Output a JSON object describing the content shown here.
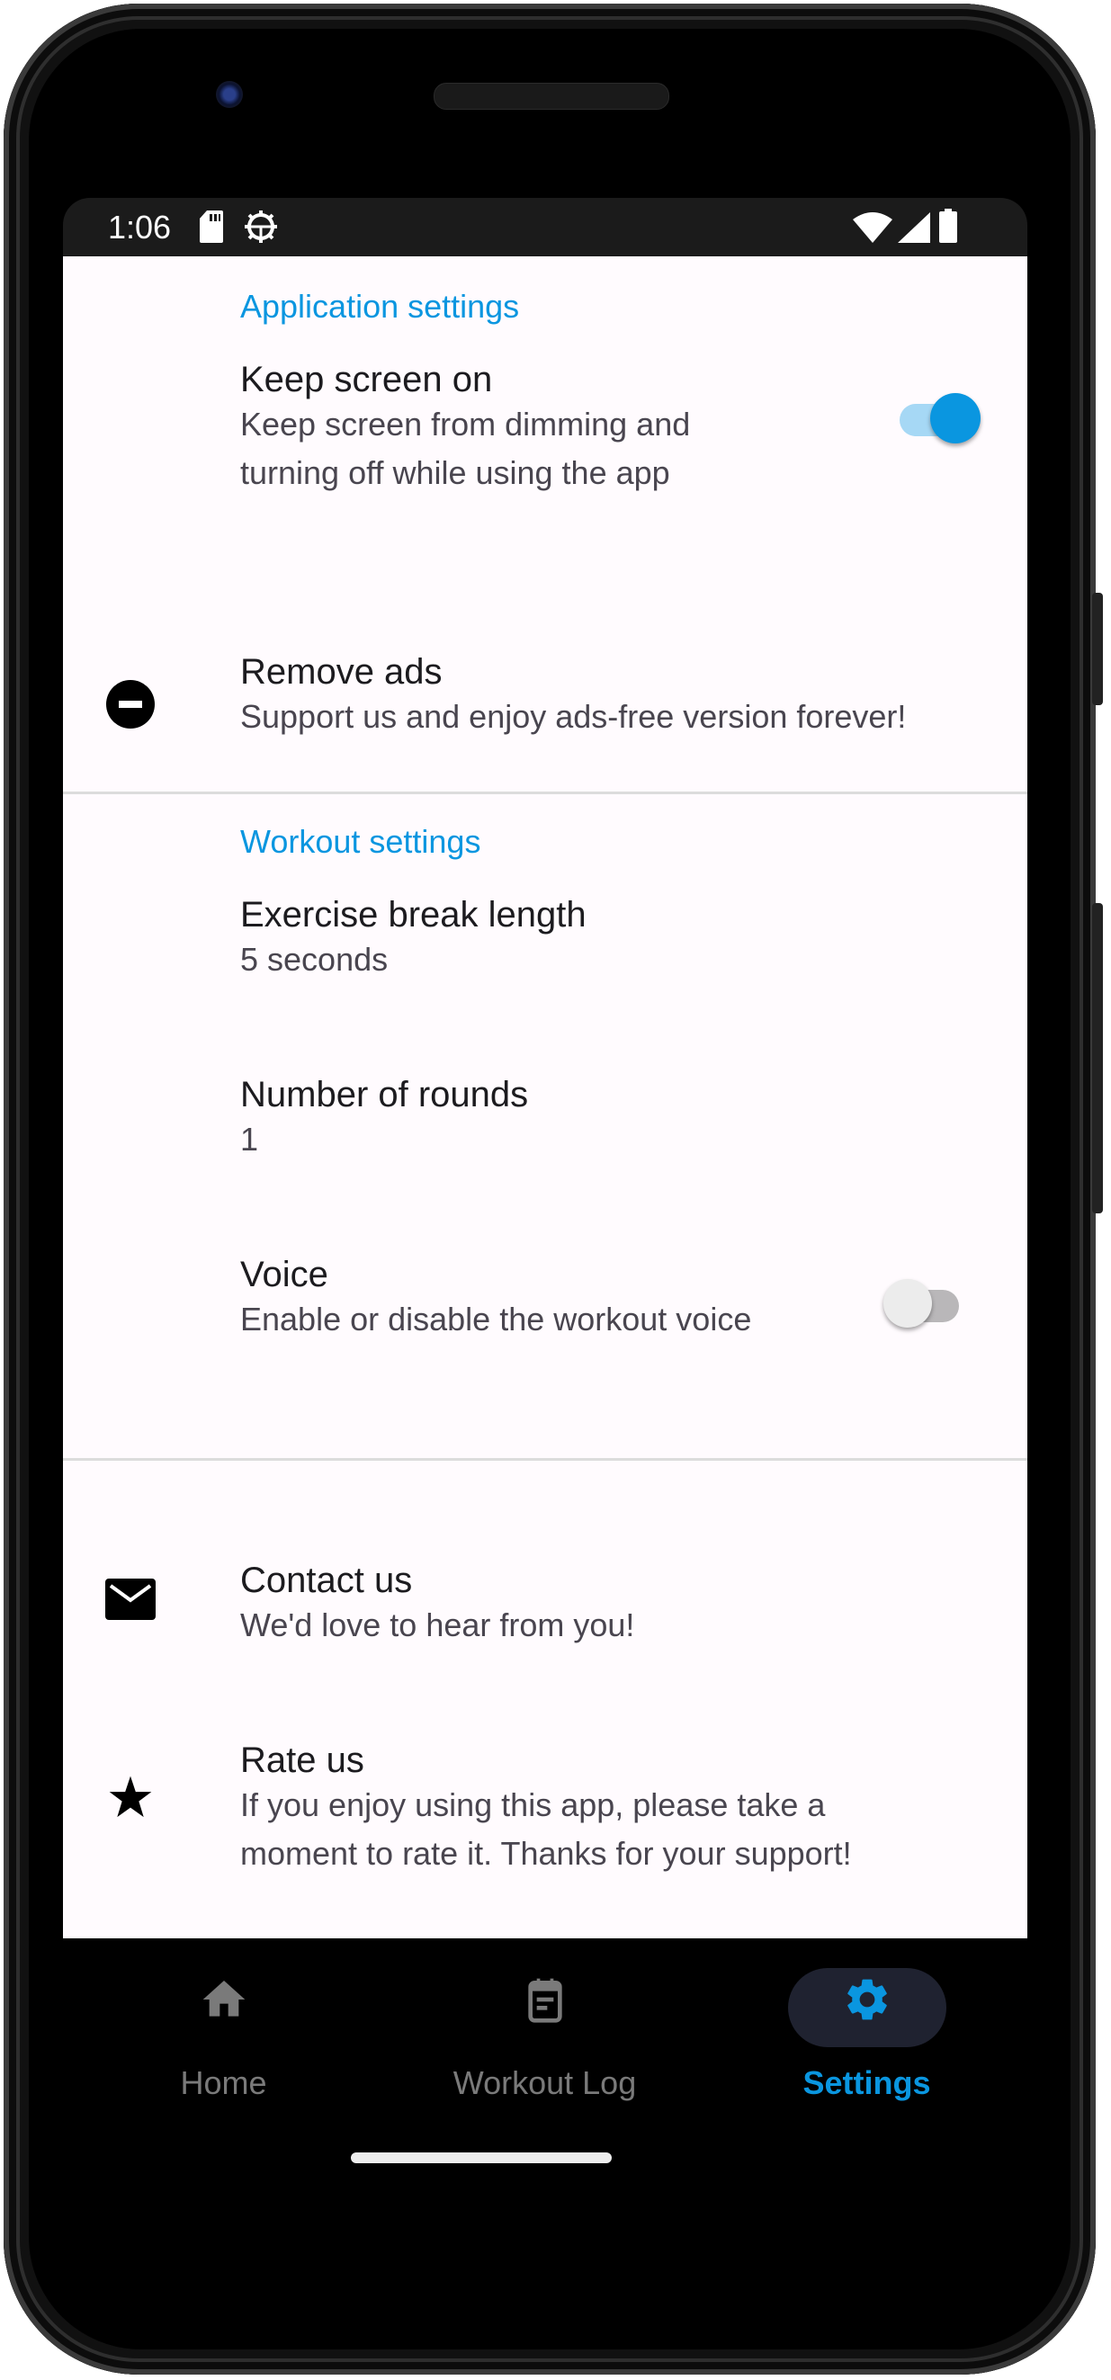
{
  "status_bar": {
    "time": "1:06",
    "left_icons": [
      "sd-card-icon",
      "android-debug-icon"
    ],
    "right_icons": [
      "wifi-icon",
      "cellular-signal-icon",
      "battery-icon"
    ]
  },
  "sections": [
    {
      "title": "Application settings",
      "items": [
        {
          "title": "Keep screen on",
          "subtitle_lines": [
            "Keep screen from dimming and",
            "turning off while using the app"
          ],
          "control": "toggle",
          "checked": true
        },
        {
          "title": "Remove ads",
          "subtitle": "Support us and enjoy ads-free version forever!",
          "icon": "remove-circle-icon"
        }
      ]
    },
    {
      "title": "Workout settings",
      "items": [
        {
          "title": "Exercise break length",
          "subtitle": "5 seconds"
        },
        {
          "title": "Number of rounds",
          "subtitle": "1"
        },
        {
          "title": "Voice",
          "subtitle": "Enable or disable the workout voice",
          "control": "toggle",
          "checked": false
        }
      ]
    },
    {
      "title": "",
      "items": [
        {
          "title": "Contact us",
          "subtitle": "We'd love to hear from you!",
          "icon": "mail-icon"
        },
        {
          "title": "Rate us",
          "subtitle_lines": [
            "If you enjoy using this app, please take a",
            "moment to rate it. Thanks for your support!"
          ],
          "icon": "star-icon"
        }
      ]
    }
  ],
  "bottom_nav": {
    "items": [
      {
        "label": "Home",
        "icon": "home-icon",
        "active": false
      },
      {
        "label": "Workout Log",
        "icon": "clipboard-icon",
        "active": false
      },
      {
        "label": "Settings",
        "icon": "gear-icon",
        "active": true
      }
    ]
  },
  "colors": {
    "accent": "#0a96e0",
    "background": "#fffbfe",
    "toggle_on_track": "#a6d8f5",
    "toggle_off_track": "#b9b7b9",
    "toggle_off_thumb": "#ececec",
    "nav_inactive": "#7a7a7a",
    "nav_active_pill": "#1f2230"
  }
}
